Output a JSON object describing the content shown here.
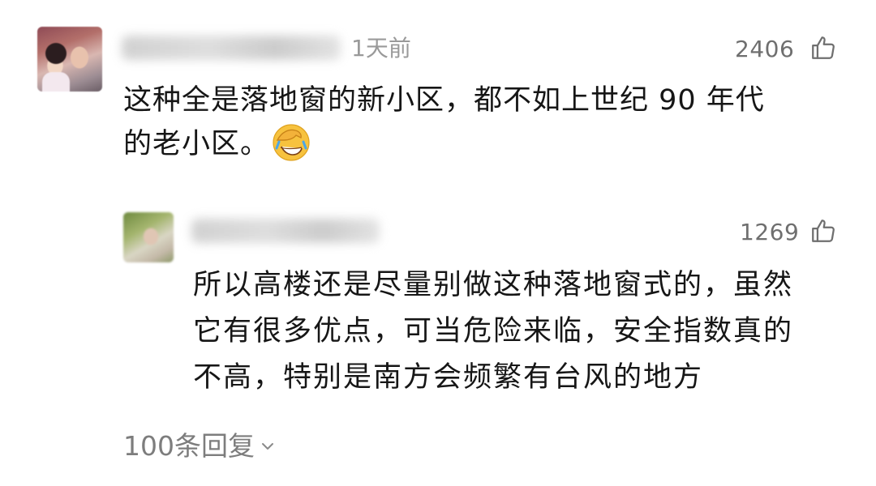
{
  "comment": {
    "time": "1天前",
    "likes": "2406",
    "text_line1": "这种全是落地窗的新小区，都不如上世纪 90 年代",
    "text_line2": "的老小区。",
    "emoji": "face-palm-laughing-emoji"
  },
  "reply": {
    "likes": "1269",
    "text_line1": "所以高楼还是尽量别做这种落地窗式的，虽然",
    "text_line2": "它有很多优点，可当危险来临，安全指数真的",
    "text_line3": "不高，特别是南方会频繁有台风的地方"
  },
  "replies_link": {
    "label": "100条回复"
  },
  "icons": {
    "like": "thumb-up-icon",
    "expand": "chevron-down-icon"
  },
  "colors": {
    "text": "#161616",
    "meta": "#9a9a9a",
    "count": "#6f6f6f",
    "emoji_face": "#f7c23e"
  }
}
